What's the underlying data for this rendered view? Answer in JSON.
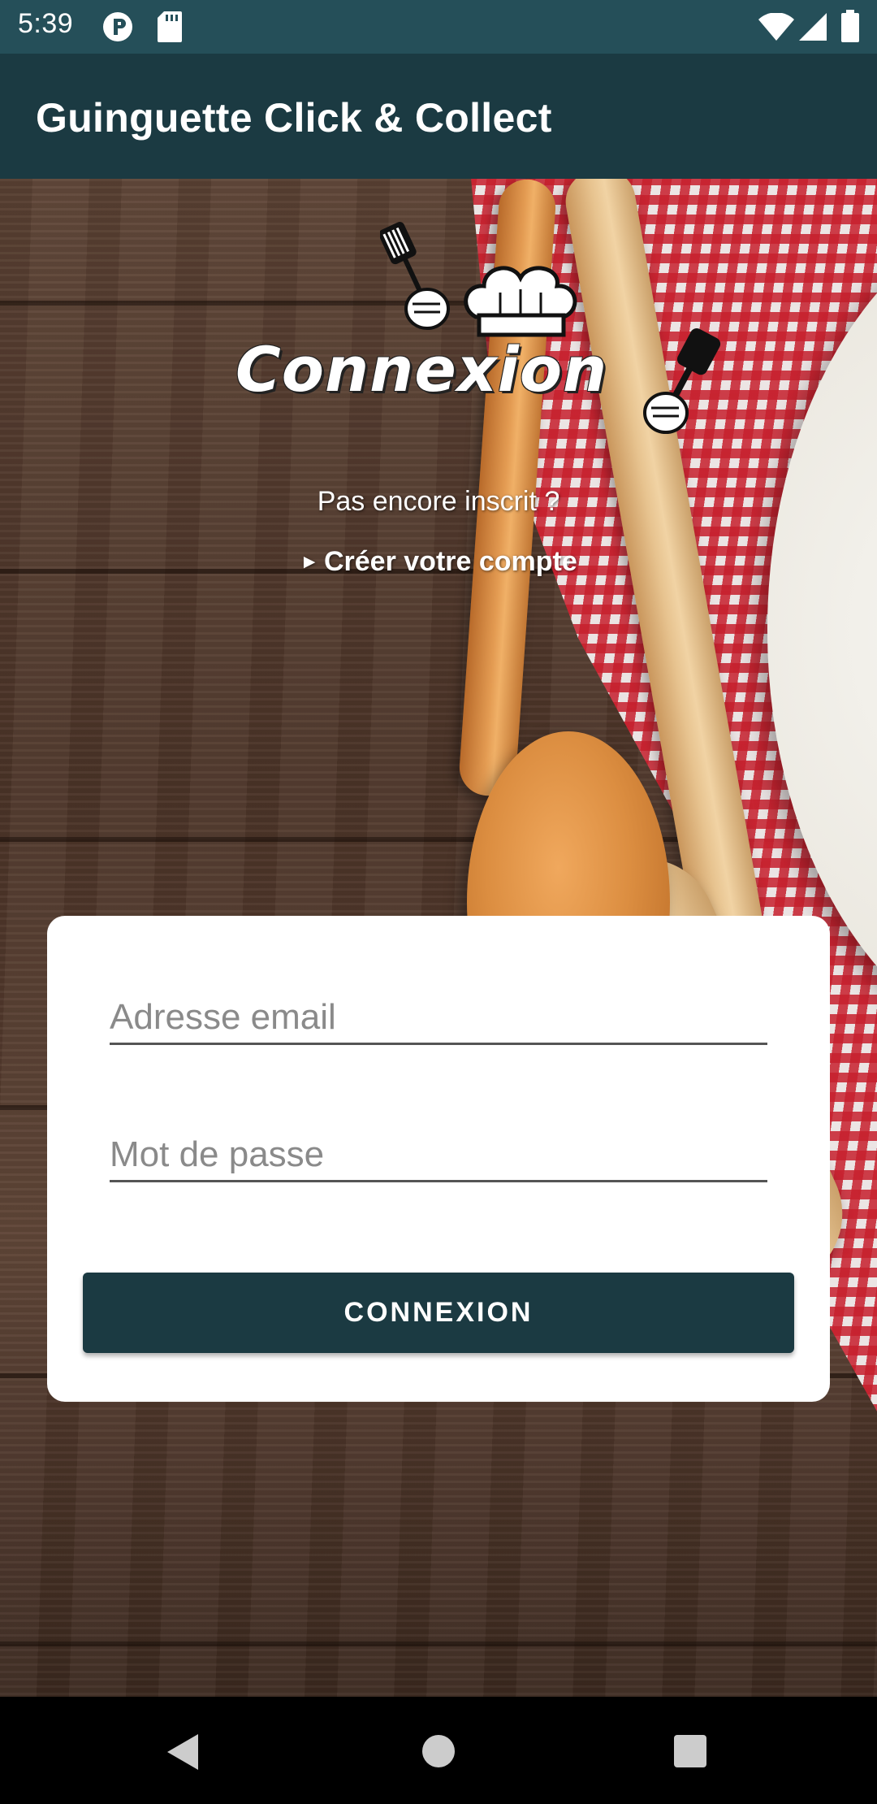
{
  "status_bar": {
    "time": "5:39",
    "icons": [
      "p-badge-icon",
      "sd-card-icon",
      "wifi-icon",
      "signal-icon",
      "battery-icon"
    ]
  },
  "app_bar": {
    "title": "Guinguette Click & Collect",
    "color": "#1b3a42"
  },
  "header": {
    "logo_text": "Connexion",
    "signup_question": "Pas encore inscrit ?",
    "signup_link": "Créer votre compte"
  },
  "login_form": {
    "email_placeholder": "Adresse email",
    "email_value": "",
    "password_placeholder": "Mot de passe",
    "password_value": "",
    "submit_label": "CONNEXION"
  },
  "nav_bar": {
    "buttons": [
      "back-icon",
      "home-icon",
      "recents-icon"
    ]
  },
  "colors": {
    "primary": "#1b3a42",
    "status_bar": "#254f59"
  }
}
